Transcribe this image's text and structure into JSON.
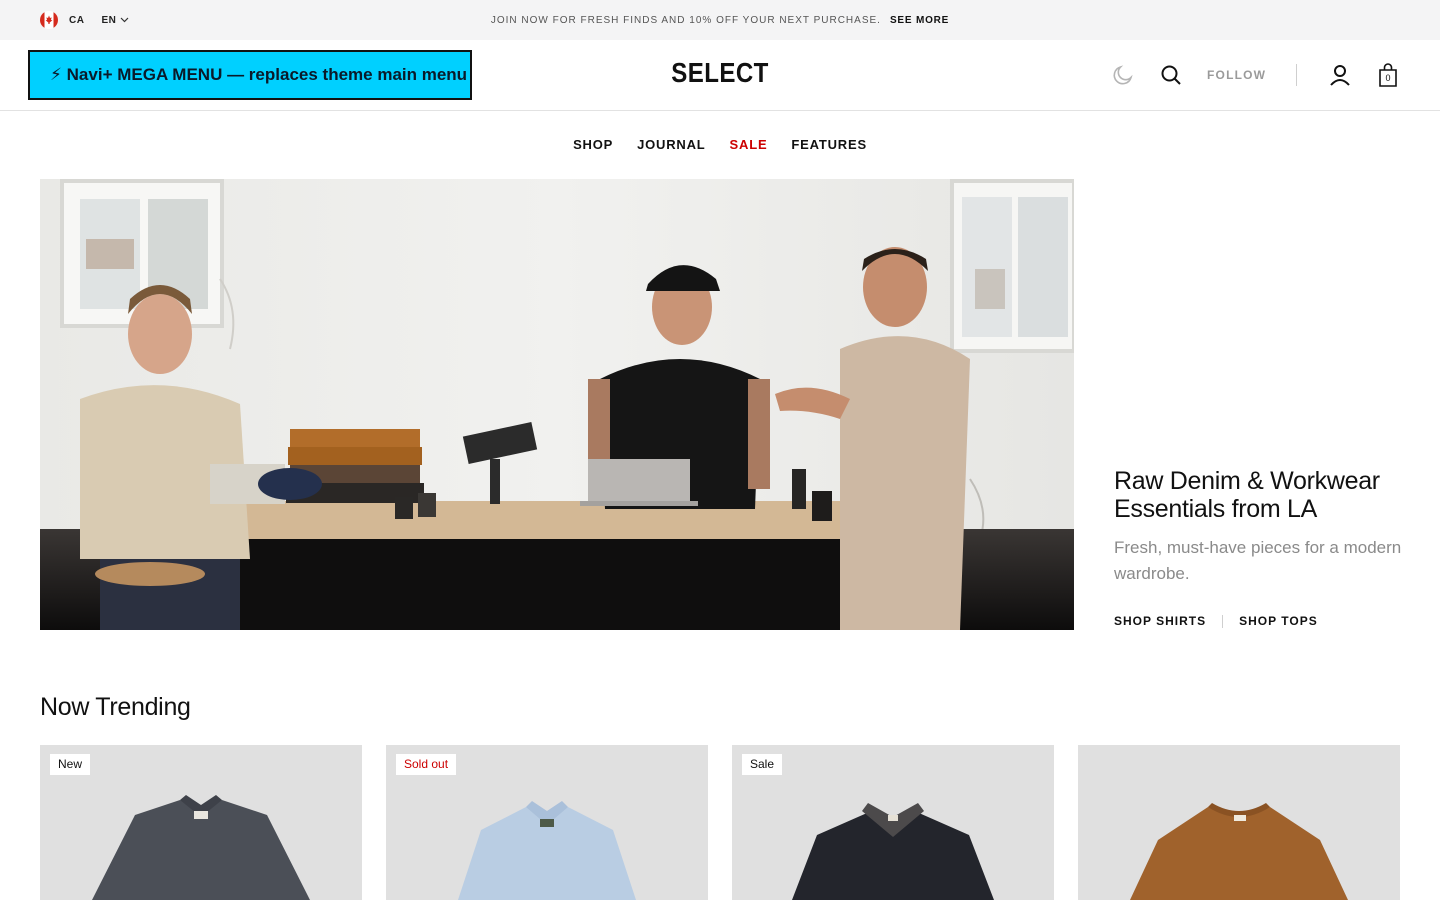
{
  "topbar": {
    "country": "CA",
    "language": "EN",
    "announcement": "JOIN NOW FOR FRESH FINDS AND 10% OFF YOUR NEXT PURCHASE.",
    "see_more": "SEE MORE"
  },
  "header": {
    "mega_menu_label": "⚡ Navi+ MEGA MENU — replaces theme main menu",
    "logo": "SELECT",
    "follow": "FOLLOW",
    "cart_count": "0",
    "icons": [
      "moon-icon",
      "search-icon",
      "account-icon",
      "cart-icon"
    ]
  },
  "nav": {
    "items": [
      {
        "label": "SHOP"
      },
      {
        "label": "JOURNAL"
      },
      {
        "label": "SALE"
      },
      {
        "label": "FEATURES"
      }
    ]
  },
  "hero": {
    "title": "Raw Denim & Workwear Essentials from LA",
    "subtitle": "Fresh, must-have pieces for a modern wardrobe.",
    "links": [
      {
        "label": "SHOP SHIRTS"
      },
      {
        "label": "SHOP TOPS"
      }
    ]
  },
  "trending": {
    "title": "Now Trending",
    "products": [
      {
        "badge": "New"
      },
      {
        "badge": "Sold out"
      },
      {
        "badge": "Sale"
      },
      {
        "badge": ""
      }
    ]
  },
  "colors": {
    "accent_mega_menu": "#00d0ff",
    "sale_red": "#cc0000",
    "topbar_bg": "#f4f4f5"
  }
}
